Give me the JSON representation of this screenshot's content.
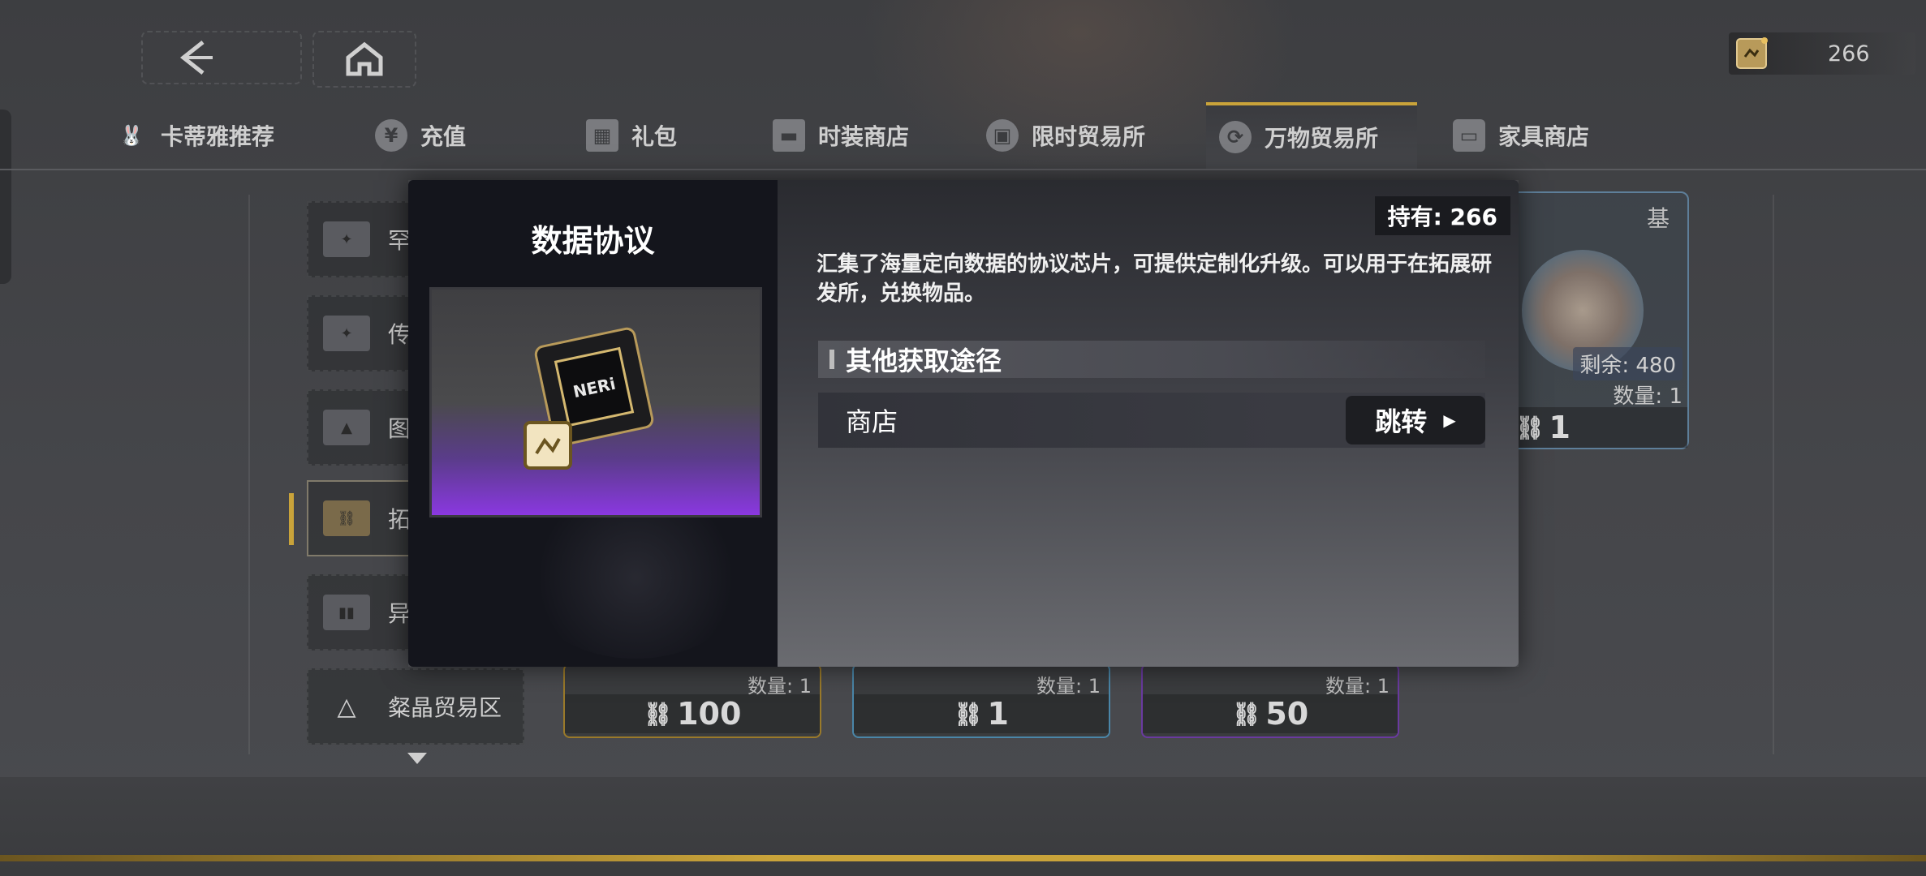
{
  "topbar": {
    "currency_value": "266"
  },
  "tabs": [
    {
      "label": "卡蒂雅推荐",
      "icon": "bunny-icon"
    },
    {
      "label": "充值",
      "icon": "yen-icon"
    },
    {
      "label": "礼包",
      "icon": "gift-icon"
    },
    {
      "label": "时装商店",
      "icon": "card-icon"
    },
    {
      "label": "限时贸易所",
      "icon": "grid-icon"
    },
    {
      "label": "万物贸易所",
      "icon": "exchange-icon",
      "active": true
    },
    {
      "label": "家具商店",
      "icon": "sofa-icon"
    }
  ],
  "sidebar": {
    "items": [
      {
        "label": "罕"
      },
      {
        "label": "传"
      },
      {
        "label": "图"
      },
      {
        "label": "拓",
        "active": true
      },
      {
        "label": "异"
      },
      {
        "label": "粲晶贸易区"
      }
    ]
  },
  "shop": {
    "cards": [
      {
        "qty": "数量: 1",
        "price": "100",
        "color": "#9a7a2a"
      },
      {
        "qty": "数量: 1",
        "price": "1",
        "color": "#4a86a8"
      },
      {
        "qty": "数量: 1",
        "price": "50",
        "color": "#6a3aa0"
      }
    ],
    "right_card": {
      "title": "基",
      "remaining": "剩余: 480",
      "qty": "数量: 1",
      "price": "1"
    }
  },
  "modal": {
    "title": "数据协议",
    "owned": "持有: 266",
    "description": "汇集了海量定向数据的协议芯片，可提供定制化升级。可以用于在拓展研发所，兑换物品。",
    "section_title": "其他获取途径",
    "source_name": "商店",
    "jump_label": "跳转",
    "chip_text": "NERi"
  },
  "colors": {
    "accent_gold": "#c9a33a",
    "rarity_purple": "#8a38e0"
  }
}
